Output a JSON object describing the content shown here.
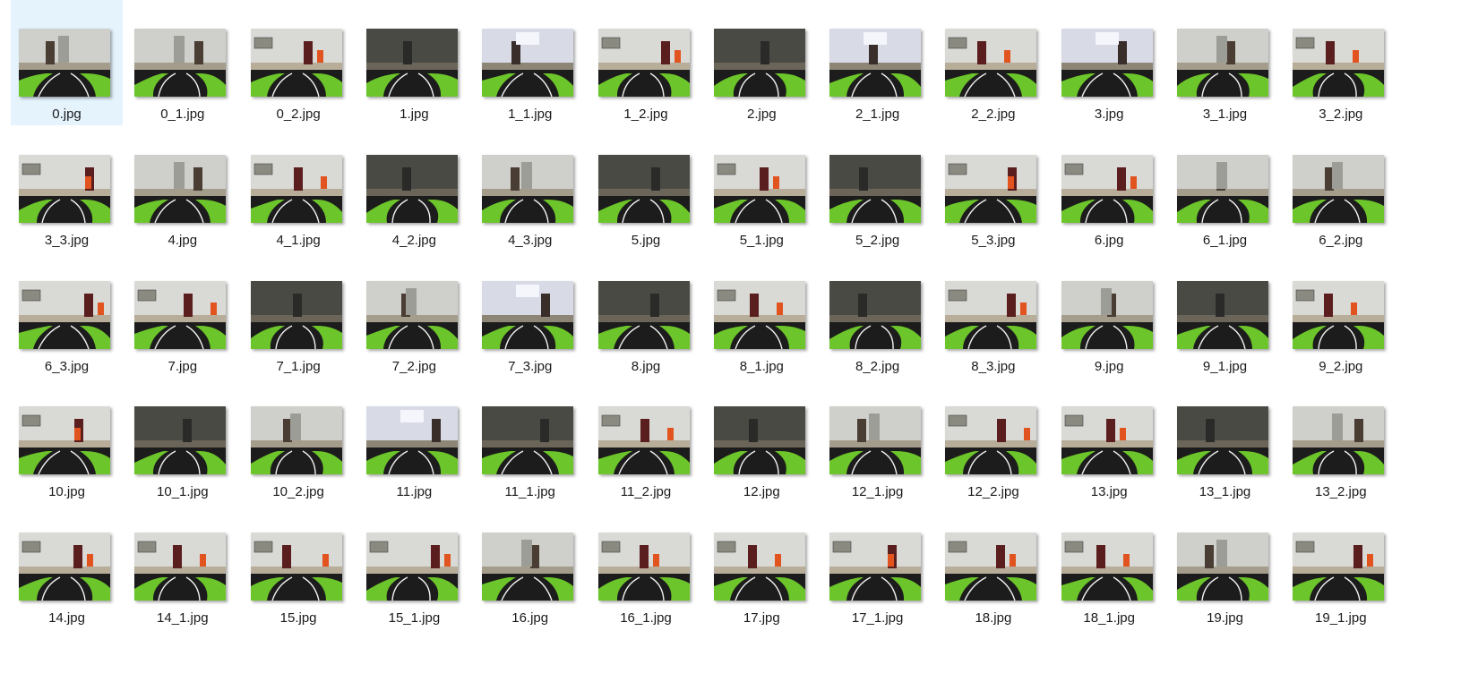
{
  "window": {
    "view": "large-icons"
  },
  "selected_index": 0,
  "colors": {
    "selection": "#e5f3fd",
    "track_green": "#6cc52a",
    "track_black": "#1c1c1c",
    "track_line": "#f2f2f2"
  },
  "files": [
    {
      "name": "0.jpg",
      "scene": "hall"
    },
    {
      "name": "0_1.jpg",
      "scene": "hall"
    },
    {
      "name": "0_2.jpg",
      "scene": "living"
    },
    {
      "name": "1.jpg",
      "scene": "dark"
    },
    {
      "name": "1_1.jpg",
      "scene": "window"
    },
    {
      "name": "1_2.jpg",
      "scene": "living"
    },
    {
      "name": "2.jpg",
      "scene": "dark"
    },
    {
      "name": "2_1.jpg",
      "scene": "window"
    },
    {
      "name": "2_2.jpg",
      "scene": "living"
    },
    {
      "name": "3.jpg",
      "scene": "window"
    },
    {
      "name": "3_1.jpg",
      "scene": "hall"
    },
    {
      "name": "3_2.jpg",
      "scene": "living"
    },
    {
      "name": "3_3.jpg",
      "scene": "living"
    },
    {
      "name": "4.jpg",
      "scene": "hall"
    },
    {
      "name": "4_1.jpg",
      "scene": "living"
    },
    {
      "name": "4_2.jpg",
      "scene": "dark"
    },
    {
      "name": "4_3.jpg",
      "scene": "hall"
    },
    {
      "name": "5.jpg",
      "scene": "dark"
    },
    {
      "name": "5_1.jpg",
      "scene": "living"
    },
    {
      "name": "5_2.jpg",
      "scene": "dark"
    },
    {
      "name": "5_3.jpg",
      "scene": "living"
    },
    {
      "name": "6.jpg",
      "scene": "living"
    },
    {
      "name": "6_1.jpg",
      "scene": "hall"
    },
    {
      "name": "6_2.jpg",
      "scene": "hall"
    },
    {
      "name": "6_3.jpg",
      "scene": "living"
    },
    {
      "name": "7.jpg",
      "scene": "living"
    },
    {
      "name": "7_1.jpg",
      "scene": "dark"
    },
    {
      "name": "7_2.jpg",
      "scene": "hall"
    },
    {
      "name": "7_3.jpg",
      "scene": "window"
    },
    {
      "name": "8.jpg",
      "scene": "dark"
    },
    {
      "name": "8_1.jpg",
      "scene": "living"
    },
    {
      "name": "8_2.jpg",
      "scene": "dark"
    },
    {
      "name": "8_3.jpg",
      "scene": "living"
    },
    {
      "name": "9.jpg",
      "scene": "hall"
    },
    {
      "name": "9_1.jpg",
      "scene": "dark"
    },
    {
      "name": "9_2.jpg",
      "scene": "living"
    },
    {
      "name": "10.jpg",
      "scene": "living"
    },
    {
      "name": "10_1.jpg",
      "scene": "dark"
    },
    {
      "name": "10_2.jpg",
      "scene": "hall"
    },
    {
      "name": "11.jpg",
      "scene": "window"
    },
    {
      "name": "11_1.jpg",
      "scene": "dark"
    },
    {
      "name": "11_2.jpg",
      "scene": "living"
    },
    {
      "name": "12.jpg",
      "scene": "dark"
    },
    {
      "name": "12_1.jpg",
      "scene": "hall"
    },
    {
      "name": "12_2.jpg",
      "scene": "living"
    },
    {
      "name": "13.jpg",
      "scene": "living"
    },
    {
      "name": "13_1.jpg",
      "scene": "dark"
    },
    {
      "name": "13_2.jpg",
      "scene": "hall"
    },
    {
      "name": "14.jpg",
      "scene": "living"
    },
    {
      "name": "14_1.jpg",
      "scene": "living"
    },
    {
      "name": "15.jpg",
      "scene": "living"
    },
    {
      "name": "15_1.jpg",
      "scene": "living"
    },
    {
      "name": "16.jpg",
      "scene": "hall"
    },
    {
      "name": "16_1.jpg",
      "scene": "living"
    },
    {
      "name": "17.jpg",
      "scene": "living"
    },
    {
      "name": "17_1.jpg",
      "scene": "living"
    },
    {
      "name": "18.jpg",
      "scene": "living"
    },
    {
      "name": "18_1.jpg",
      "scene": "living"
    },
    {
      "name": "19.jpg",
      "scene": "hall"
    },
    {
      "name": "19_1.jpg",
      "scene": "living"
    }
  ]
}
